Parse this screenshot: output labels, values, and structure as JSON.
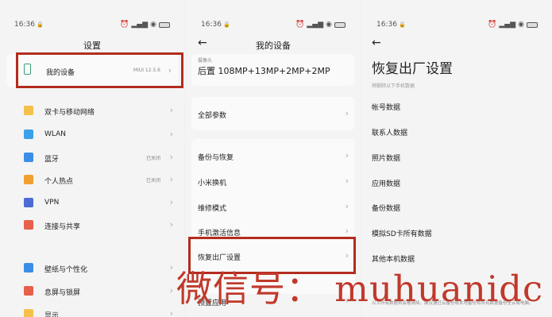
{
  "status_bar": {
    "time": "16:36"
  },
  "panel1": {
    "title": "设置",
    "my_device": {
      "label": "我的设备",
      "value": "MIUI 12.5.6"
    },
    "items": [
      {
        "label": "双卡与移动网络",
        "value": "",
        "icon": "sim-card-icon",
        "color": "#f5c04a"
      },
      {
        "label": "WLAN",
        "value": "",
        "icon": "wifi-icon",
        "color": "#3aa1e8"
      },
      {
        "label": "蓝牙",
        "value": "已关闭",
        "icon": "bluetooth-icon",
        "color": "#3a8ee8"
      },
      {
        "label": "个人热点",
        "value": "已关闭",
        "icon": "hotspot-icon",
        "color": "#f0a030"
      },
      {
        "label": "VPN",
        "value": "",
        "icon": "vpn-icon",
        "color": "#4a6cd4"
      },
      {
        "label": "连接与共享",
        "value": "",
        "icon": "share-icon",
        "color": "#e8604a"
      }
    ],
    "items2": [
      {
        "label": "壁纸与个性化",
        "icon": "wallpaper-icon",
        "color": "#3a8ee8"
      },
      {
        "label": "息屏与锁屏",
        "icon": "lock-icon",
        "color": "#e8604a"
      },
      {
        "label": "显示",
        "icon": "sun-icon",
        "color": "#f5c04a"
      }
    ]
  },
  "panel2": {
    "title": "我的设备",
    "camera_label": "摄像头",
    "camera_value": "后置 108MP+13MP+2MP+2MP",
    "items": [
      {
        "label": "全部参数"
      },
      {
        "label": "备份与恢复"
      },
      {
        "label": "小米换机"
      },
      {
        "label": "维修模式"
      },
      {
        "label": "手机激活信息"
      },
      {
        "label": "恢复出厂设置"
      },
      {
        "label": "预置应用"
      }
    ]
  },
  "panel3": {
    "title": "恢复出厂设置",
    "subtitle": "将删除以下手机数据",
    "items": [
      "帐号数据",
      "联系人数据",
      "照片数据",
      "应用数据",
      "备份数据",
      "模拟SD卡所有数据",
      "其他本机数据"
    ],
    "footer": "以上所有数据将会被清除，建议通过云备份或本地备份将所有数据备份至云或电脑。"
  },
  "watermark": "微信号： muhuanidc",
  "accent_color": "#b32c1e"
}
